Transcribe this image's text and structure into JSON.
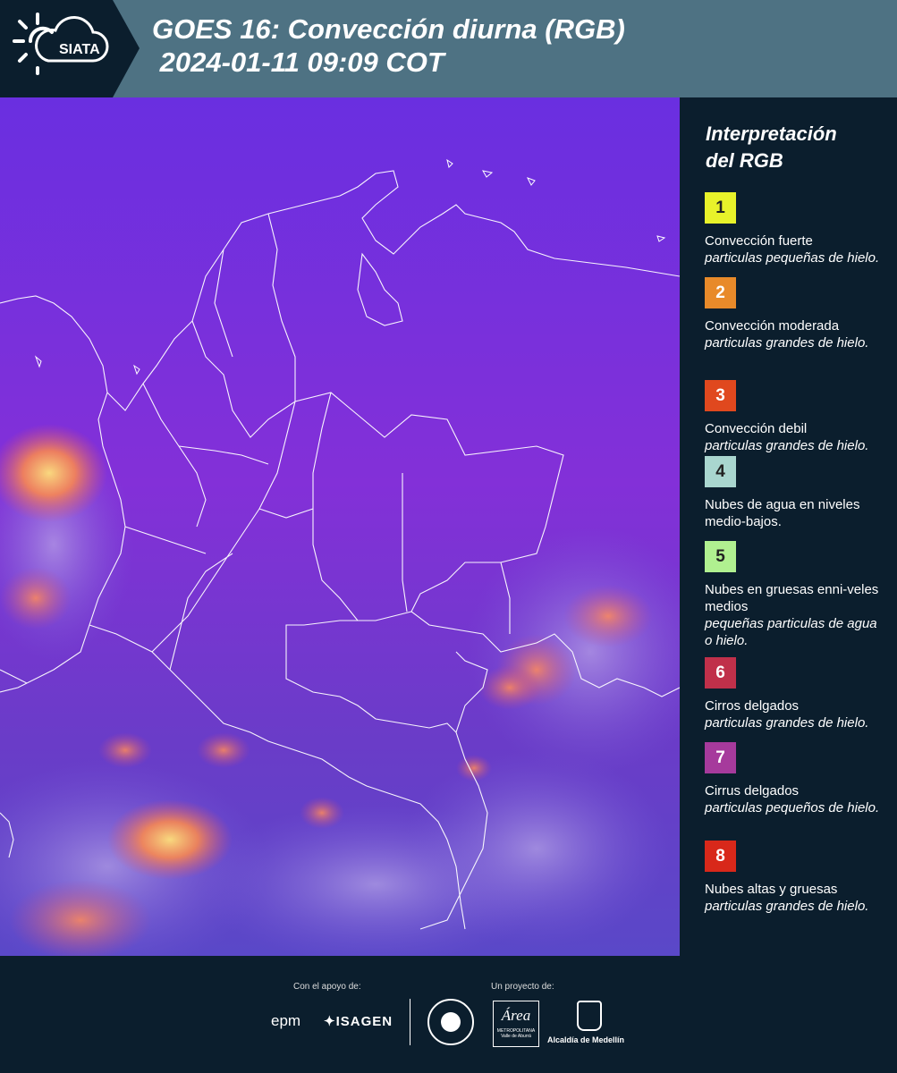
{
  "header": {
    "title": "GOES 16: Convección diurna (RGB)\n 2024-01-11 09:09 COT",
    "logo": {
      "text": "SIATA",
      "icon": "sun-cloud-icon"
    }
  },
  "map": {
    "description_icon": "satellite-rgb-map",
    "colors": {
      "background": "#7a2ee0",
      "border": "#ffffff",
      "hot": "#ff8a4a"
    }
  },
  "legend": {
    "title": "Interpretación\ndel RGB",
    "items": [
      {
        "number": "1",
        "color": "#e8f22a",
        "name": "Convección fuerte",
        "desc": "particulas pequeñas de hielo."
      },
      {
        "number": "2",
        "color": "#e88a2a",
        "name": "Convección moderada",
        "desc": "particulas grandes de hielo."
      },
      {
        "number": "3",
        "color": "#e0481e",
        "name": "Convección debil",
        "desc": "particulas grandes de hielo."
      },
      {
        "number": "4",
        "color": "#a9d6cf",
        "name": "Nubes de agua en niveles medio-bajos.",
        "desc": ""
      },
      {
        "number": "5",
        "color": "#b0f090",
        "name": "Nubes en gruesas enni-veles medios",
        "desc": "pequeñas particulas de agua o hielo."
      },
      {
        "number": "6",
        "color": "#c0304a",
        "name": "Cirros delgados",
        "desc": "particulas grandes de hielo."
      },
      {
        "number": "7",
        "color": "#a63a9c",
        "name": "Cirrus delgados",
        "desc": "particulas pequeños de hielo."
      },
      {
        "number": "8",
        "color": "#d8281a",
        "name": "Nubes altas y gruesas",
        "desc": "particulas grandes de hielo."
      }
    ]
  },
  "footer": {
    "support_label": "Con el apoyo de:",
    "project_label": "Un proyecto de:",
    "logos": {
      "epm": "epm",
      "isagen": "ISAGEN",
      "area": "Área",
      "area_sub": "METROPOLITANA",
      "area_sub2": "Valle de Aburrá",
      "medellin": "Alcaldía de Medellín"
    }
  }
}
